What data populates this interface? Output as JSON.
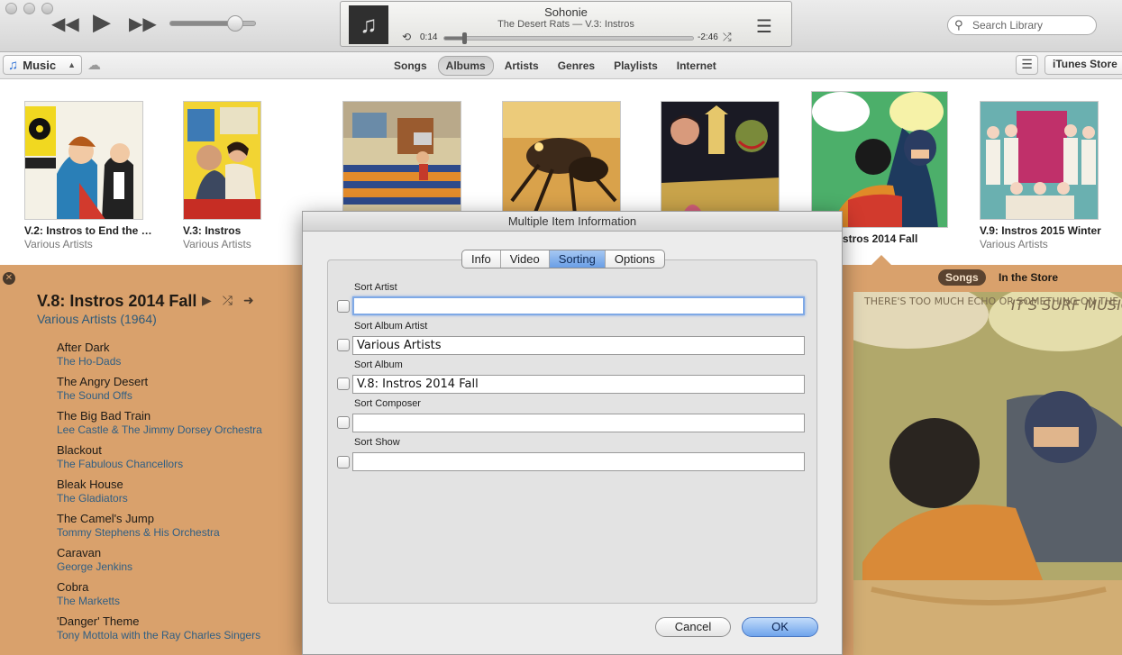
{
  "player": {
    "song_title": "Sohonie",
    "song_subtitle": "The Desert Rats — V.3: Instros",
    "elapsed": "0:14",
    "remaining": "-2:46",
    "progress_fraction": 0.08,
    "volume_fraction": 0.75,
    "icons": [
      "rewind-icon",
      "play-icon",
      "fast-forward-icon",
      "repeat-icon",
      "shuffle-icon",
      "up-next-list-icon",
      "music-note-icon"
    ]
  },
  "search": {
    "placeholder": "Search Library"
  },
  "nav": {
    "library": "Music",
    "tabs": [
      {
        "label": "Songs",
        "active": false
      },
      {
        "label": "Albums",
        "active": true
      },
      {
        "label": "Artists",
        "active": false
      },
      {
        "label": "Genres",
        "active": false
      },
      {
        "label": "Playlists",
        "active": false
      },
      {
        "label": "Internet",
        "active": false
      }
    ],
    "store_label": "iTunes Store"
  },
  "albums": [
    {
      "title": "V.2: Instros to End the World",
      "artist": "Various Artists"
    },
    {
      "title": "V.3: Instros",
      "artist": "Various Artists"
    },
    {
      "title": "",
      "artist": ""
    },
    {
      "title": "",
      "artist": ""
    },
    {
      "title": "",
      "artist": ""
    },
    {
      "title": "V.8: Instros 2014 Fall",
      "artist": ""
    },
    {
      "title": "V.9: Instros 2015 Winter",
      "artist": "Various Artists"
    }
  ],
  "panel": {
    "title": "V.8: Instros 2014 Fall",
    "artist_line": "Various Artists (1964)",
    "segment_active": "Songs",
    "segment_other": "In the Store",
    "tracks": [
      {
        "name": "After Dark",
        "artist": "The Ho-Dads"
      },
      {
        "name": "The Angry Desert",
        "artist": "The Sound Offs"
      },
      {
        "name": "The Big Bad Train",
        "artist": "Lee Castle & The Jimmy Dorsey Orchestra"
      },
      {
        "name": "Blackout",
        "artist": "The Fabulous Chancellors"
      },
      {
        "name": "Bleak House",
        "artist": "The Gladiators"
      },
      {
        "name": "The Camel's Jump",
        "artist": "Tommy Stephens & His Orchestra"
      },
      {
        "name": "Caravan",
        "artist": "George Jenkins"
      },
      {
        "name": "Cobra",
        "artist": "The Marketts"
      },
      {
        "name": "'Danger' Theme",
        "artist": "Tony Mottola with the Ray Charles Singers"
      }
    ],
    "art_text_1": "THERE'S TOO MUCH ECHO OR SOMETHING ON THE GUIT....",
    "art_text_2": "IT'S SURF MUSIC!"
  },
  "dialog": {
    "title": "Multiple Item Information",
    "tabs": [
      {
        "label": "Info",
        "active": false
      },
      {
        "label": "Video",
        "active": false
      },
      {
        "label": "Sorting",
        "active": true
      },
      {
        "label": "Options",
        "active": false
      }
    ],
    "fields": [
      {
        "label": "Sort Artist",
        "value": "",
        "checked": false
      },
      {
        "label": "Sort Album Artist",
        "value": "Various Artists",
        "checked": false
      },
      {
        "label": "Sort Album",
        "value": "V.8: Instros 2014 Fall",
        "checked": false
      },
      {
        "label": "Sort Composer",
        "value": "",
        "checked": false
      },
      {
        "label": "Sort Show",
        "value": "",
        "checked": false
      }
    ],
    "cancel_label": "Cancel",
    "ok_label": "OK"
  },
  "colors": {
    "panel_bg": "#d9a16c",
    "accent_blue": "#2b6fd6",
    "track_artist": "#2e5e84"
  }
}
